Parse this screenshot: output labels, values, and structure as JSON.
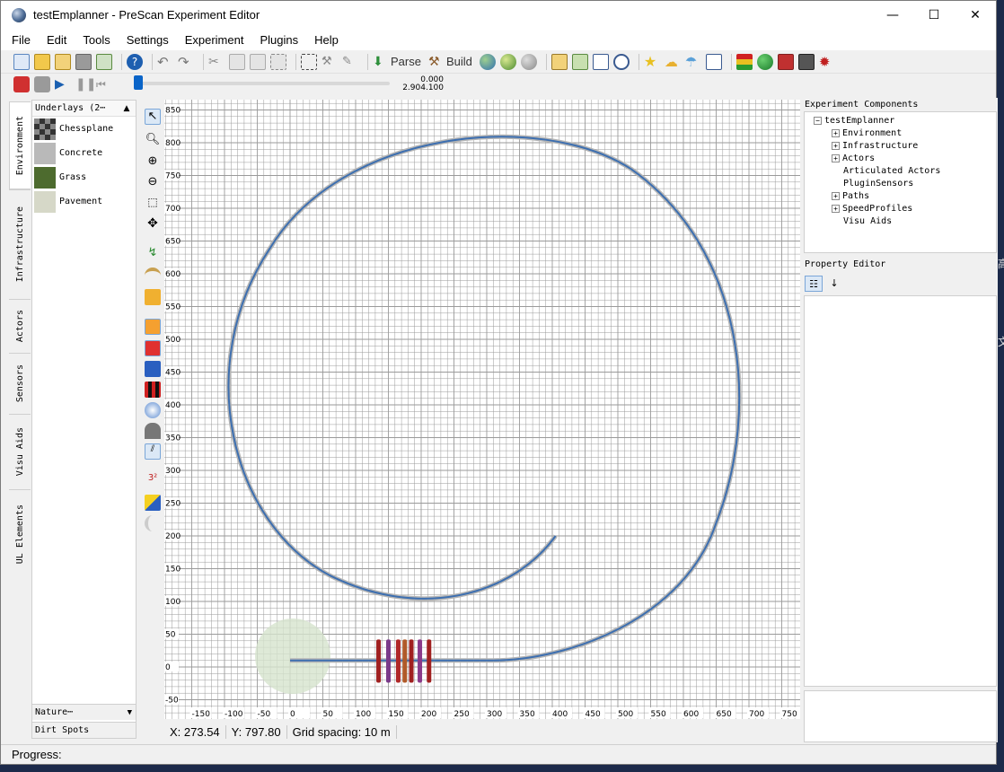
{
  "window": {
    "title": "testEmplanner - PreScan Experiment Editor",
    "minimize": "—",
    "maximize": "☐",
    "close": "✕"
  },
  "menu": [
    "File",
    "Edit",
    "Tools",
    "Settings",
    "Experiment",
    "Plugins",
    "Help"
  ],
  "toolbar": {
    "parse_label": "Parse",
    "build_label": "Build"
  },
  "playback": {
    "time_current": "0.000",
    "time_total": "2.904.100",
    "progress": 0
  },
  "left_tabs": [
    "Environment",
    "Infrastructure",
    "Actors",
    "Sensors",
    "Visu Aids",
    "UL Elements"
  ],
  "underlays": {
    "header": "Underlays  (2⋯",
    "items": [
      {
        "label": "Chessplane",
        "color": "#555555"
      },
      {
        "label": "Concrete",
        "color": "#b9b9b9"
      },
      {
        "label": "Grass",
        "color": "#4d6b2e"
      },
      {
        "label": "Pavement",
        "color": "#d6d8c8"
      }
    ],
    "nature_label": "Nature⋯",
    "dirt_label": "Dirt Spots"
  },
  "canvas": {
    "x_ticks": [
      "-150",
      "-100",
      "-50",
      "0",
      "50",
      "100",
      "150",
      "200",
      "250",
      "300",
      "350",
      "400",
      "450",
      "500",
      "550",
      "600",
      "650",
      "700",
      "750"
    ],
    "y_ticks": [
      "850",
      "800",
      "750",
      "700",
      "650",
      "600",
      "550",
      "500",
      "450",
      "400",
      "350",
      "300",
      "250",
      "200",
      "150",
      "100",
      "50",
      "0",
      "-50"
    ],
    "grid_color": "#9a9a9a",
    "road_color": "#3d6fb0"
  },
  "status": {
    "x": "X: 273.54",
    "y": "Y: 797.80",
    "grid": "Grid spacing: 10 m"
  },
  "progress_label": "Progress:",
  "experiment_components": {
    "header": "Experiment Components",
    "root": "testEmplanner",
    "children": [
      "Environment",
      "Infrastructure",
      "Actors",
      "Articulated Actors",
      "PluginSensors",
      "Paths",
      "SpeedProfiles",
      "Visu Aids"
    ]
  },
  "property_editor": {
    "header": "Property Editor"
  },
  "external_glyphs": [
    "高",
    "文"
  ]
}
